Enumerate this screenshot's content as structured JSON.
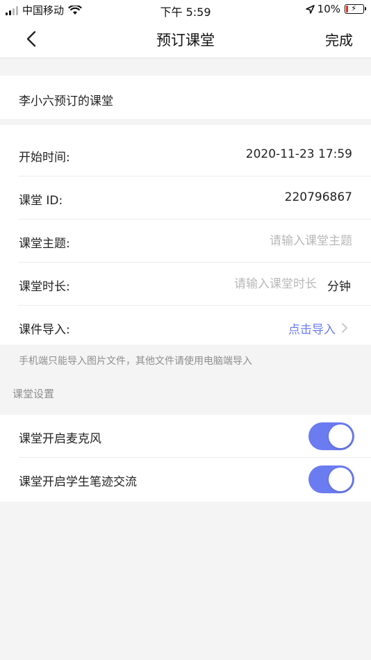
{
  "status_bar": {
    "carrier": "中国移动",
    "time": "下午 5:59",
    "battery_percent": "10%",
    "icons": [
      "signal-icon",
      "wifi-icon",
      "location-arrow-icon",
      "battery-charging-icon"
    ]
  },
  "nav": {
    "title": "预订课堂",
    "done_label": "完成",
    "back_icon": "chevron-left-icon"
  },
  "booking_name": "李小六预订的课堂",
  "form": {
    "start_time": {
      "label": "开始时间:",
      "value": "2020-11-23 17:59"
    },
    "class_id": {
      "label": "课堂 ID:",
      "value": "220796867"
    },
    "topic": {
      "label": "课堂主题:",
      "placeholder": "请输入课堂主题",
      "value": ""
    },
    "duration": {
      "label": "课堂时长:",
      "placeholder": "请输入课堂时长",
      "unit": "分钟",
      "value": ""
    },
    "courseware": {
      "label": "课件导入:",
      "link": "点击导入",
      "icon": "chevron-right-icon"
    }
  },
  "hint": "手机端只能导入图片文件，其他文件请使用电脑端导入",
  "settings": {
    "header": "课堂设置",
    "items": [
      {
        "label": "课堂开启麦克风",
        "enabled": true
      },
      {
        "label": "课堂开启学生笔迹交流",
        "enabled": true
      }
    ]
  },
  "colors": {
    "accent": "#6b7cf0",
    "background": "#f4f4f4",
    "placeholder": "#b8b8b8",
    "hint": "#8e8e8e",
    "battery_low": "#e0302a"
  }
}
